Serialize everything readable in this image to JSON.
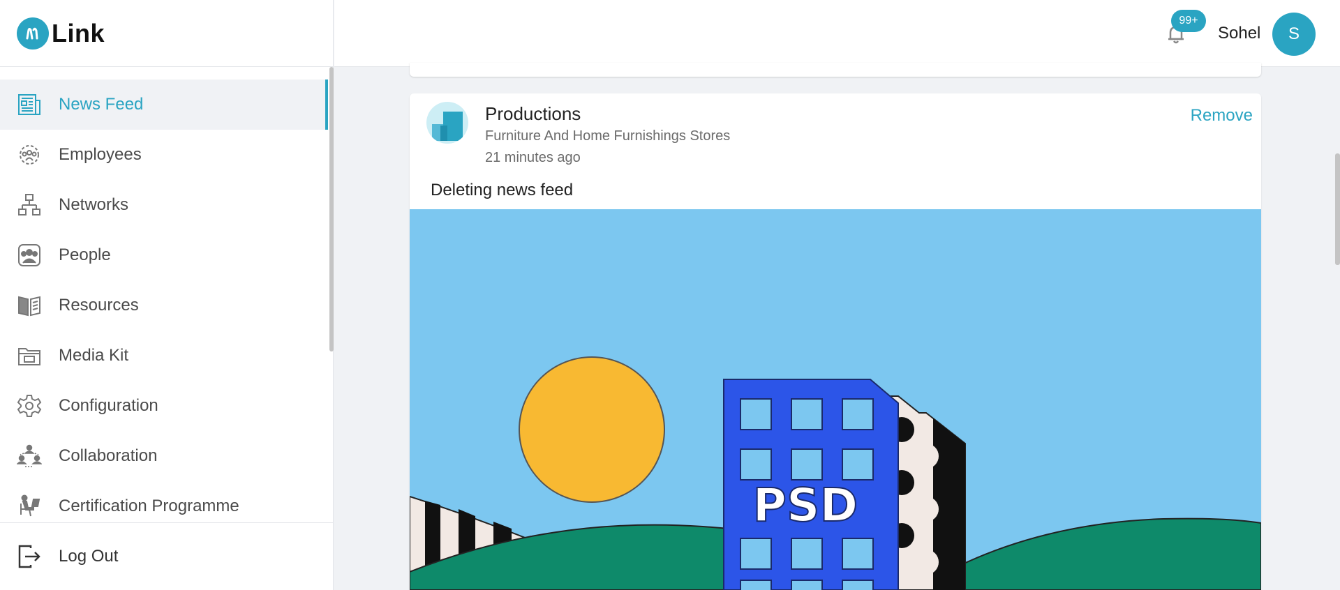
{
  "app": {
    "logo_text": "Link",
    "accent_color": "#2aa4c2"
  },
  "sidebar": {
    "items": [
      {
        "label": "News Feed",
        "icon": "newspaper-icon",
        "active": true
      },
      {
        "label": "Employees",
        "icon": "employees-gear-icon"
      },
      {
        "label": "Networks",
        "icon": "network-icon"
      },
      {
        "label": "People",
        "icon": "people-icon"
      },
      {
        "label": "Resources",
        "icon": "book-icon"
      },
      {
        "label": "Media Kit",
        "icon": "folder-icon"
      },
      {
        "label": "Configuration",
        "icon": "gear-icon"
      },
      {
        "label": "Collaboration",
        "icon": "collaboration-icon"
      },
      {
        "label": "Certification Programme",
        "icon": "certification-icon"
      }
    ],
    "logout_label": "Log Out"
  },
  "header": {
    "notification_count": "99+",
    "user_name": "Sohel",
    "avatar_initial": "S"
  },
  "post": {
    "org_name": "Productions",
    "org_category": "Furniture And Home Furnishings Stores",
    "time": "21 minutes ago",
    "remove_label": "Remove",
    "text": "Deleting news feed",
    "image_text": "PSD"
  }
}
